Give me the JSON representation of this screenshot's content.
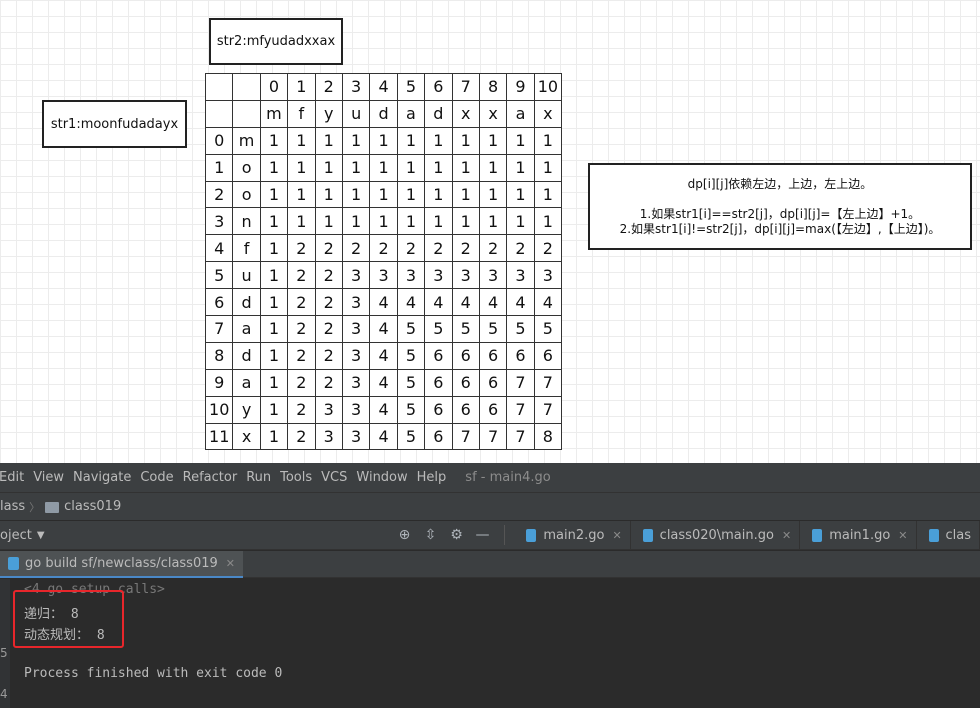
{
  "board": {
    "str2_label": "str2:mfyudadxxax",
    "str1_label": "str1:moonfudadayx",
    "note": {
      "line1": "dp[i][j]依赖左边，上边，左上边。",
      "line2": "1.如果str1[i]==str2[j]，dp[i][j]=【左上边】+1。",
      "line3": "2.如果str1[i]!=str2[j]，dp[i][j]=max(【左边】,【上边】)。"
    },
    "table": {
      "col_indices": [
        "0",
        "1",
        "2",
        "3",
        "4",
        "5",
        "6",
        "7",
        "8",
        "9",
        "10"
      ],
      "col_chars": [
        "m",
        "f",
        "y",
        "u",
        "d",
        "a",
        "d",
        "x",
        "x",
        "a",
        "x"
      ],
      "rows": [
        {
          "idx": "0",
          "ch": "m",
          "vals": [
            "1",
            "1",
            "1",
            "1",
            "1",
            "1",
            "1",
            "1",
            "1",
            "1",
            "1"
          ]
        },
        {
          "idx": "1",
          "ch": "o",
          "vals": [
            "1",
            "1",
            "1",
            "1",
            "1",
            "1",
            "1",
            "1",
            "1",
            "1",
            "1"
          ]
        },
        {
          "idx": "2",
          "ch": "o",
          "vals": [
            "1",
            "1",
            "1",
            "1",
            "1",
            "1",
            "1",
            "1",
            "1",
            "1",
            "1"
          ]
        },
        {
          "idx": "3",
          "ch": "n",
          "vals": [
            "1",
            "1",
            "1",
            "1",
            "1",
            "1",
            "1",
            "1",
            "1",
            "1",
            "1"
          ]
        },
        {
          "idx": "4",
          "ch": "f",
          "vals": [
            "1",
            "2",
            "2",
            "2",
            "2",
            "2",
            "2",
            "2",
            "2",
            "2",
            "2"
          ]
        },
        {
          "idx": "5",
          "ch": "u",
          "vals": [
            "1",
            "2",
            "2",
            "3",
            "3",
            "3",
            "3",
            "3",
            "3",
            "3",
            "3"
          ]
        },
        {
          "idx": "6",
          "ch": "d",
          "vals": [
            "1",
            "2",
            "2",
            "3",
            "4",
            "4",
            "4",
            "4",
            "4",
            "4",
            "4"
          ]
        },
        {
          "idx": "7",
          "ch": "a",
          "vals": [
            "1",
            "2",
            "2",
            "3",
            "4",
            "5",
            "5",
            "5",
            "5",
            "5",
            "5"
          ]
        },
        {
          "idx": "8",
          "ch": "d",
          "vals": [
            "1",
            "2",
            "2",
            "3",
            "4",
            "5",
            "6",
            "6",
            "6",
            "6",
            "6"
          ]
        },
        {
          "idx": "9",
          "ch": "a",
          "vals": [
            "1",
            "2",
            "2",
            "3",
            "4",
            "5",
            "6",
            "6",
            "6",
            "7",
            "7"
          ]
        },
        {
          "idx": "10",
          "ch": "y",
          "vals": [
            "1",
            "2",
            "3",
            "3",
            "4",
            "5",
            "6",
            "6",
            "6",
            "7",
            "7"
          ]
        },
        {
          "idx": "11",
          "ch": "x",
          "vals": [
            "1",
            "2",
            "3",
            "3",
            "4",
            "5",
            "6",
            "7",
            "7",
            "7",
            "8"
          ]
        }
      ]
    }
  },
  "ide": {
    "menu": [
      "Edit",
      "View",
      "Navigate",
      "Code",
      "Refactor",
      "Run",
      "Tools",
      "VCS",
      "Window",
      "Help"
    ],
    "window_title": "sf - main4.go",
    "breadcrumb": {
      "parent": "lass",
      "current": "class019"
    },
    "project_label": "oject",
    "tool_icons": [
      "target-icon",
      "collapse-icon",
      "gear-icon",
      "minimize-icon"
    ],
    "tool_glyphs": [
      "⊕",
      "⇳",
      "⚙",
      "—"
    ],
    "editor_tabs": [
      "main2.go",
      "class020\\main.go",
      "main1.go",
      "clas"
    ],
    "run_tab": "go build sf/newclass/class019",
    "gutter_marks": [
      "5",
      "4"
    ],
    "console": {
      "setup": "<4 go setup calls>",
      "line_recursion": "递归： 8",
      "line_dp": "动态规划： 8",
      "finished": "Process finished with exit code 0"
    },
    "highlight_color": "#e8262b"
  }
}
